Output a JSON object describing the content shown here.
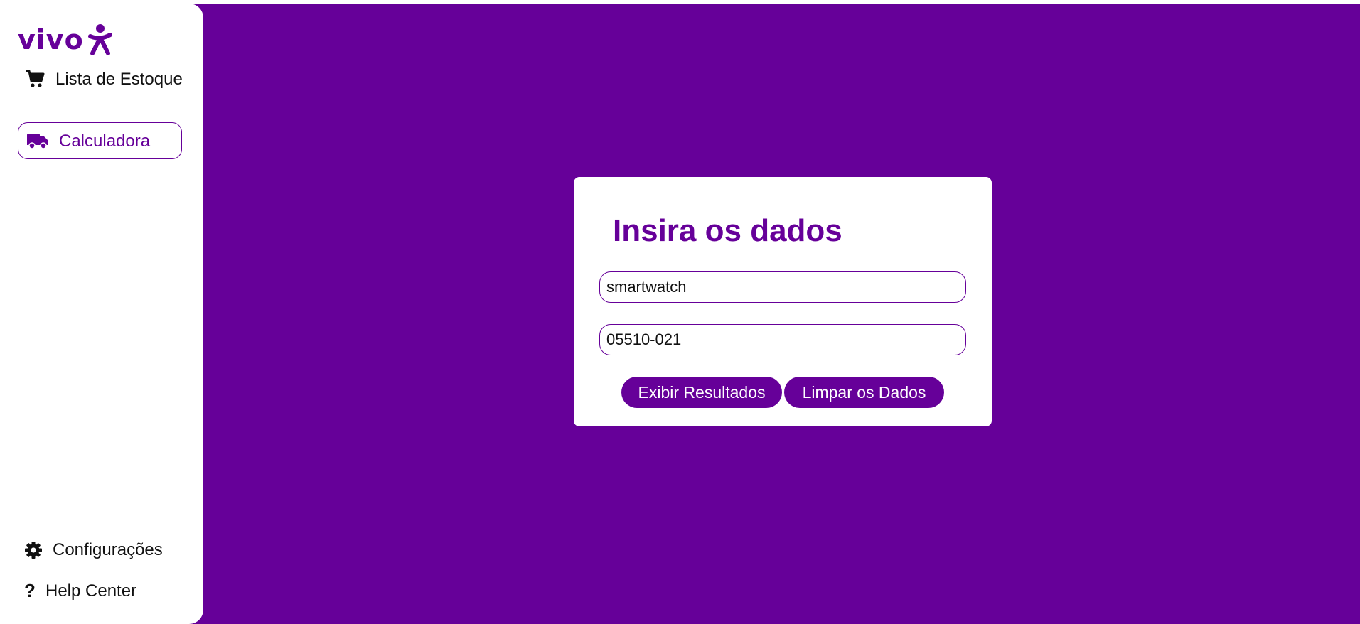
{
  "brand": {
    "logo_text": "vivo",
    "color": "#660099"
  },
  "sidebar": {
    "items": [
      {
        "label": "Lista de Estoque",
        "icon": "cart-icon"
      },
      {
        "label": "Calculadora",
        "icon": "truck-icon",
        "active": true
      }
    ],
    "footer_items": [
      {
        "label": "Configurações",
        "icon": "gear-icon"
      },
      {
        "label": "Help Center",
        "icon": "question-icon",
        "glyph": "?"
      }
    ]
  },
  "form": {
    "title": "Insira os dados",
    "product_value": "smartwatch",
    "cep_value": "05510-021",
    "show_button": "Exibir Resultados",
    "clear_button": "Limpar os Dados"
  }
}
